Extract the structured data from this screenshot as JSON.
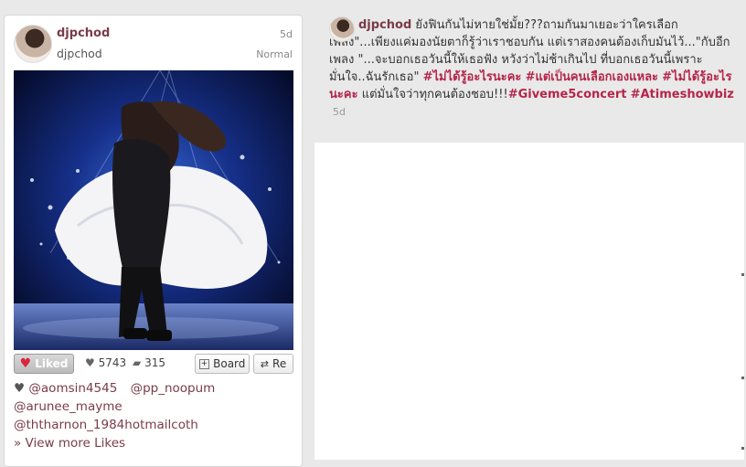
{
  "card": {
    "username": "djpchod",
    "display_name": "djpchod",
    "age": "5d",
    "status": "Normal",
    "actions": {
      "liked_label": "Liked",
      "likes_count": "5743",
      "comments_count": "315",
      "board_label": "Board",
      "repin_label": "Re"
    },
    "likers": [
      "@aomsin4545",
      "@pp_noopum",
      "@arunee_mayme",
      "@ththarnon_1984hotmailcoth"
    ],
    "view_more": "» View more Likes",
    "icons": [
      "heart-icon",
      "comment-icon",
      "plus-icon",
      "repin-icon"
    ]
  },
  "post": {
    "username": "djpchod",
    "text_1": "ยังฟินกันไม่หายใช่มั้ย???ถามกันมาเยอะว่าใครเลือกเพลง\"...เพียงแค่มองนัยตาก็รู้ว่าเราชอบกัน แต่เราสองคนต้องเก็บมันไว้...\"กับอีกเพลง \"...จะบอกเธอวันนี้ให้เธอฟัง หวังว่าไม่ช้าเกินไป ที่บอกเธอวันนี้เพราะมั่นใจ..ฉันรักเธอ\"",
    "tag_1": "#ไม่ได้รู้อะไรนะคะ",
    "tag_2": "#แต่เป็นคนเลือกเองแหละ",
    "tag_3": "#ไม่ได้รู้อะไรนะคะ",
    "text_2": "แต่มั่นใจว่าทุกคนต้องชอบ!!!",
    "tag_4": "#Giveme5concert",
    "tag_5": "#Atimeshowbiz",
    "age": "5d"
  },
  "colors": {
    "accent": "#7a3b4a",
    "tag": "#b5254a",
    "heart": "#d9263d"
  }
}
